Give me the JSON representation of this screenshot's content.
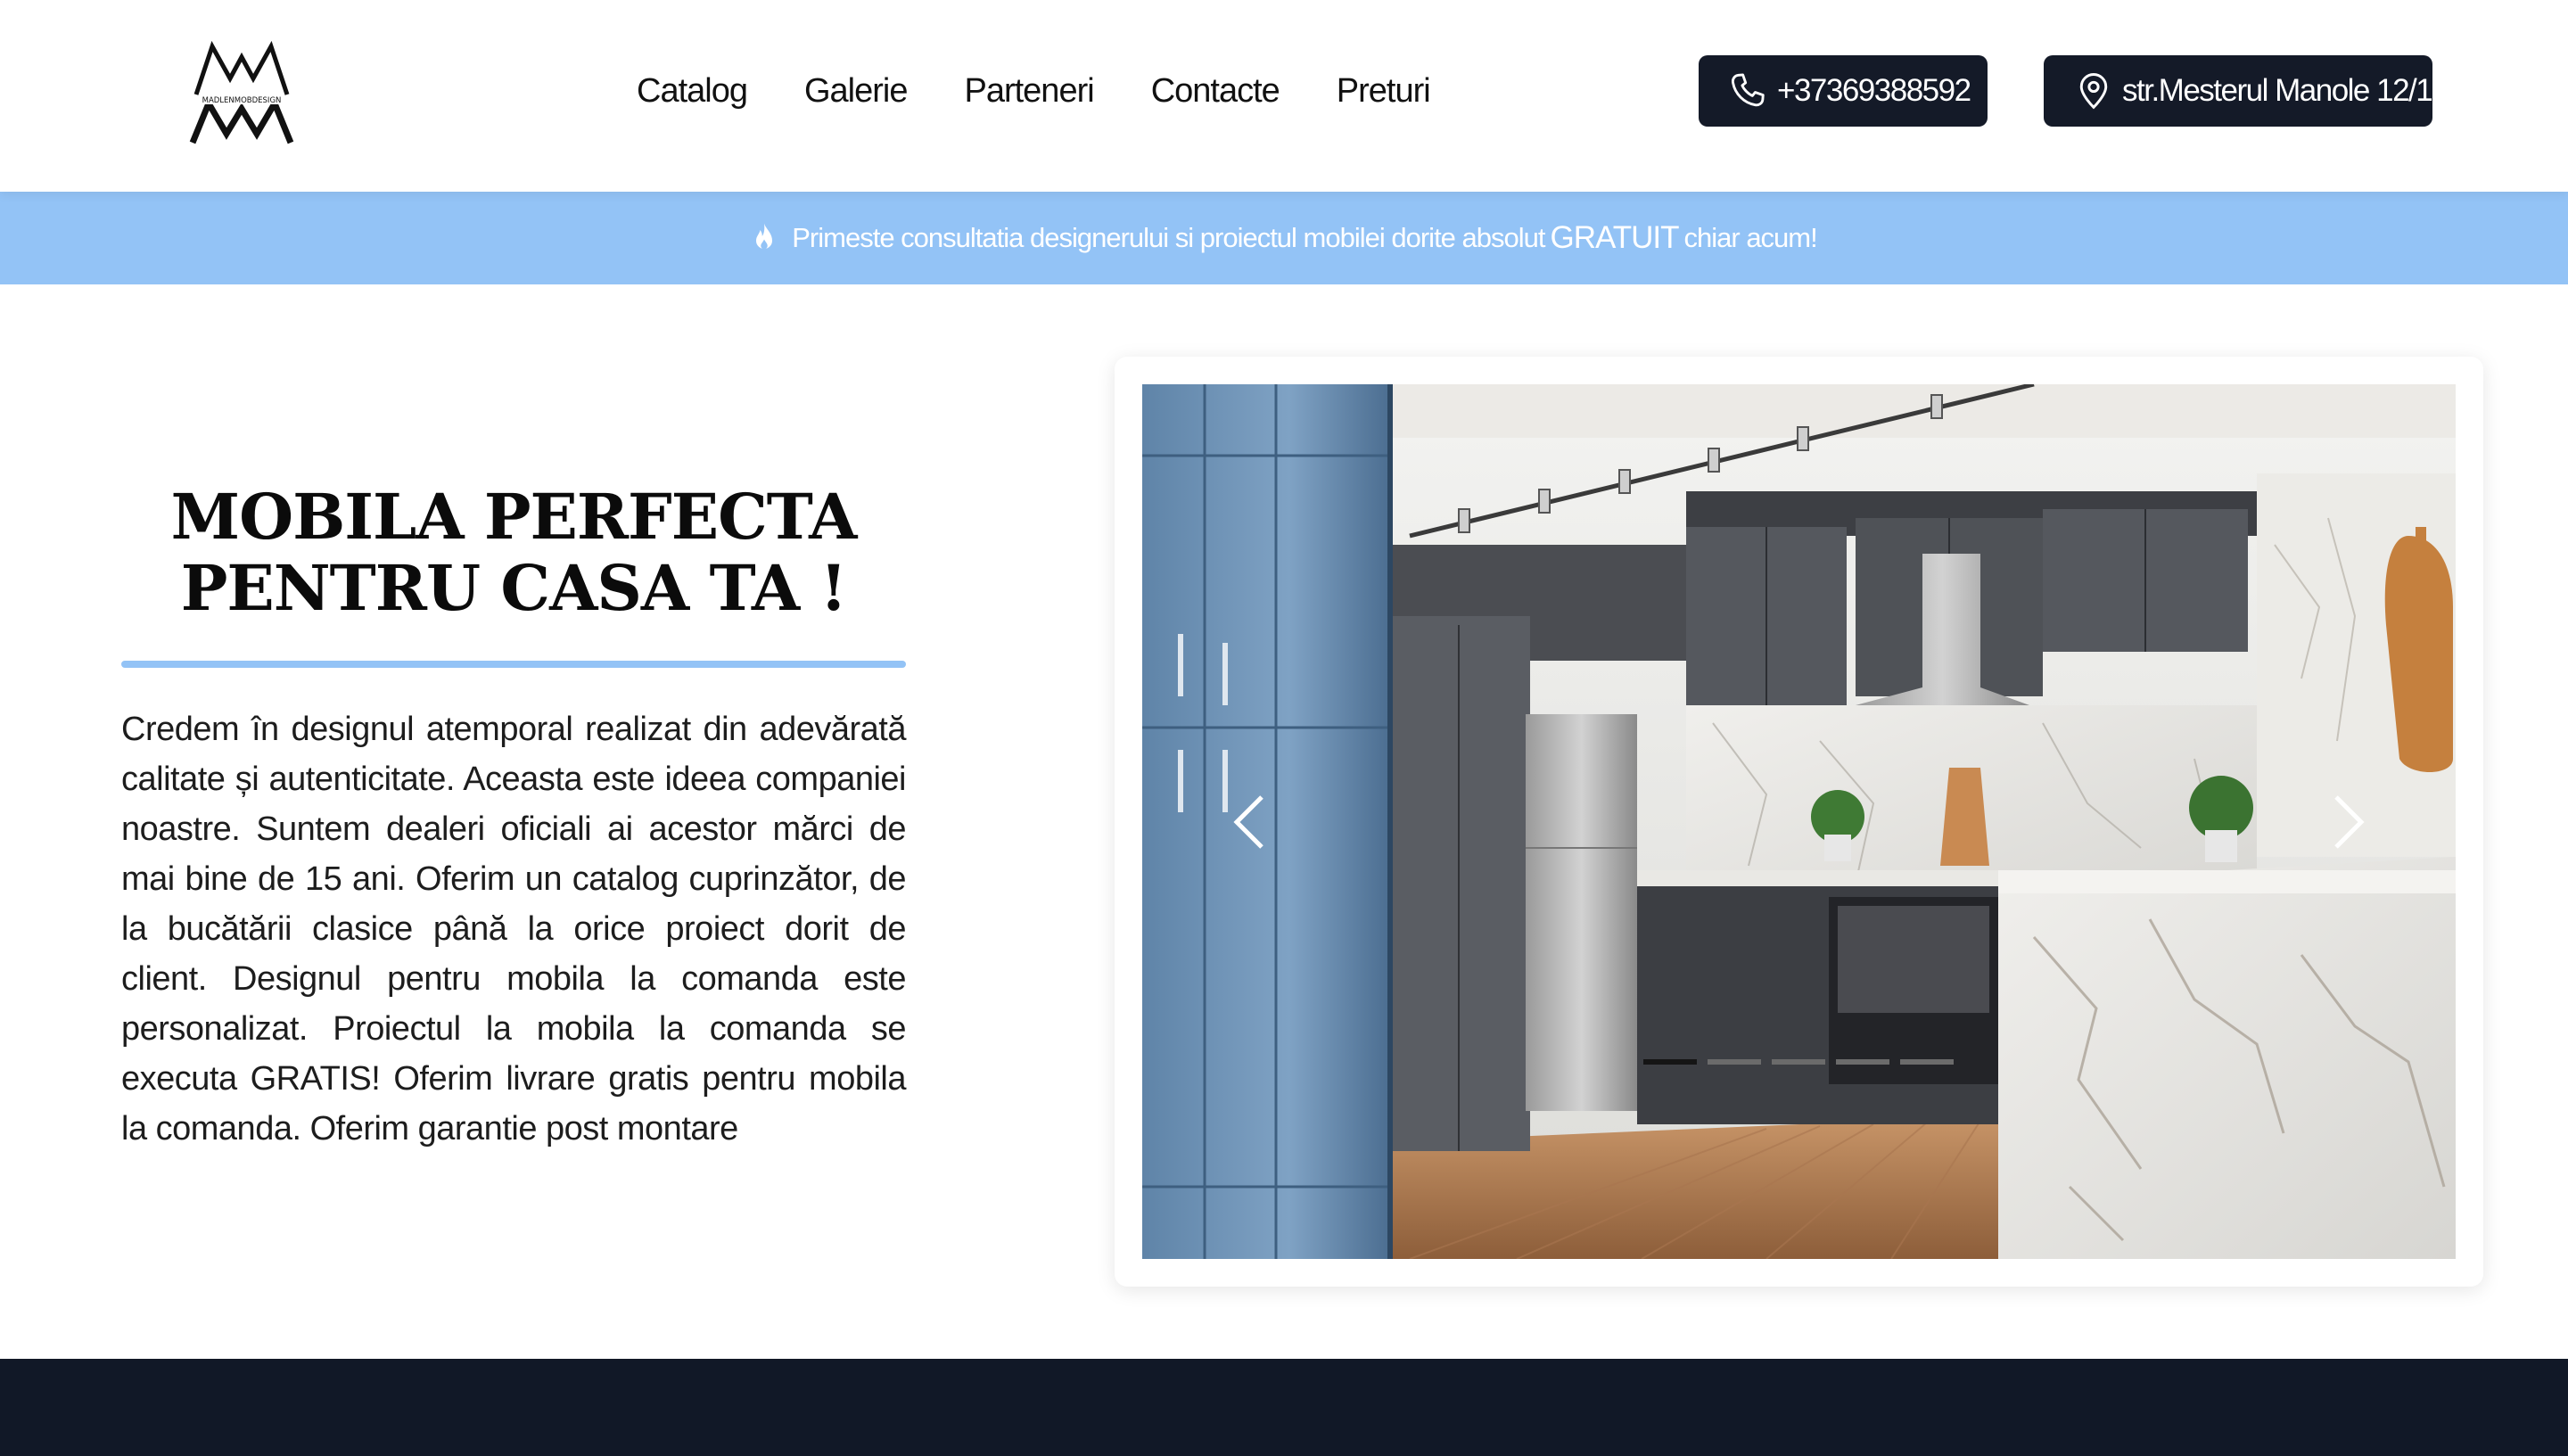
{
  "brand": {
    "logo_text": "MADLENMOBDESIGN"
  },
  "nav": {
    "items": [
      "Catalog",
      "Galerie",
      "Parteneri",
      "Contacte",
      "Preturi"
    ]
  },
  "contact": {
    "phone": "+37369388592",
    "address": "str.Mesterul Manole 12/1"
  },
  "banner": {
    "text_before": "Primeste consultatia designerului si proiectul mobilei dorite absolut",
    "text_strong": "GRATUIT",
    "text_after": "chiar acum!"
  },
  "hero": {
    "title_line1": "MOBILA PERFECTA",
    "title_line2": "PENTRU CASA TA !",
    "paragraph": "Credem în designul atemporal realizat din adevărată calitate și autenticitate. Aceasta este ideea companiei noastre. Suntem dealeri oficiali ai acestor mărci de mai bine de 15 ani. Oferim un catalog cuprinzător, de la bucătării clasice până la orice proiect dorit de client. Designul pentru mobila la comanda este personalizat. Proiectul la mobila la comanda se executa GRATIS! Oferim livrare gratis pentru mobila la comanda. Oferim garantie post montare"
  },
  "slider": {
    "slide_count": 5,
    "active_index": 0,
    "colors": {
      "active_dot": "#151515",
      "inactive_dot": "#6b6b6b"
    }
  },
  "colors": {
    "accent": "#93c3f6",
    "dark": "#141a28",
    "footer": "#111827"
  },
  "icons": [
    "phone-icon",
    "location-pin-icon",
    "flame-icon",
    "chevron-left-icon",
    "chevron-right-icon"
  ]
}
